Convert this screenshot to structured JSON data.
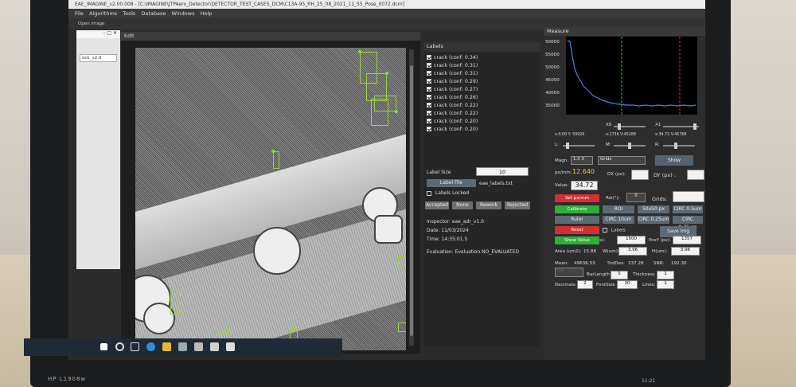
{
  "title": "EAE_IMAGINE_v2.00.008 - [C:\\IMAGINE\\JTPAero_Detector\\DETECTOR_TEST_CASES_DCM\\C13A-95_RH_25_08_2021_11_55_Pose_0072.dcm]",
  "menu": [
    "File",
    "Algorithms",
    "Tools",
    "Database",
    "Windows",
    "Help"
  ],
  "toolbar_label": "Open image",
  "left_strip_text": "ock_v2.0",
  "edit_header": "Edit",
  "labels_panel": {
    "header": "Labels",
    "items": [
      "crack (conf: 0.34)",
      "crack (conf: 0.31)",
      "crack (conf: 0.31)",
      "crack (conf: 0.29)",
      "crack (conf: 0.27)",
      "crack (conf: 0.26)",
      "crack (conf: 0.22)",
      "crack (conf: 0.22)",
      "crack (conf: 0.20)",
      "crack (conf: 0.20)"
    ],
    "label_size_label": "Label Size",
    "label_size_value": "10",
    "label_file_button": "Label File",
    "label_file_name": "eae_labels.txt",
    "labels_locked": "Labels Locked",
    "status_buttons": [
      "Accepted",
      "None",
      "Rework",
      "Rejected"
    ],
    "inspector": "Inspector: eae_adr_v1.0",
    "date": "Date: 11/03/2024",
    "time": "Time: 14:35:01.5",
    "evaluation": "Evaluation: Evaluation.NO_EVALUATED"
  },
  "measure": {
    "header": "Measure",
    "y_ticks": [
      "50000",
      "55000",
      "50000",
      "45000",
      "40000",
      "35000"
    ],
    "x0": "X0",
    "x1": "X1",
    "coord_left": "x:0.00 Y: 59926",
    "coord_mid": "x:1736 V:45288",
    "coord_right": "x:34.72 V:45768",
    "l": "L:",
    "m": "M:",
    "r": "R:",
    "magn_label": "Magn.",
    "magn_value": "1.0 X",
    "grids_select": "Grids",
    "show": "Show",
    "px_per_mm_label": "px/mm:",
    "px_per_mm": "12.640",
    "dx": "DX (px):",
    "dy": "DY (px) :",
    "value_label": "Value:",
    "value": "34.72",
    "set_px_mm": "Set px/mm",
    "roi_label": "Roi(°):",
    "roi_value": "0",
    "grids2": "Grids:",
    "calibrate": "Calibrate",
    "roi": "ROI",
    "roi_size": "50x50 px",
    "circ1": "CIRC 0.5um",
    "ruler": "Ruler",
    "circ2": "CIRC 10um",
    "circ3": "CIRC 0.25um",
    "circ4": "CIRC 0.75um",
    "reset": "Reset",
    "labels_chk": "Labels",
    "save_img": "Save Img",
    "show_value": "Show Value",
    "pos_x_label": "x):",
    "pos_x": "1500",
    "pos_y_label": "PosY (px):",
    "pos_y": "1357",
    "area_label": "Area (um2):",
    "area": "15.88",
    "w_label": "W(um):",
    "w": "3.96",
    "h_label": "H(um):",
    "h": "3.96",
    "mean_label": "Mean:",
    "mean": "49636.53",
    "stddev_label": "StdDev:",
    "stddev": "237.28",
    "snr_label": "SNR:",
    "snr": "192.30",
    "color_select": "red",
    "bar_length_label": "BarLength",
    "bar_length": "5",
    "thickness_label": "Thickness",
    "thickness": "1",
    "decimals_label": "Decimals:",
    "decimals": "2",
    "font_size_label": "FontSize",
    "font_size": "30",
    "lines_label": "Lines:",
    "lines": "1"
  },
  "monitor_brand": "HP L1908w",
  "clock": "11:21",
  "colors": {
    "accent_green": "#9bd33a",
    "plot_line": "#2c8fe0",
    "marker_green": "#3ec43e",
    "marker_red": "#e03030"
  }
}
